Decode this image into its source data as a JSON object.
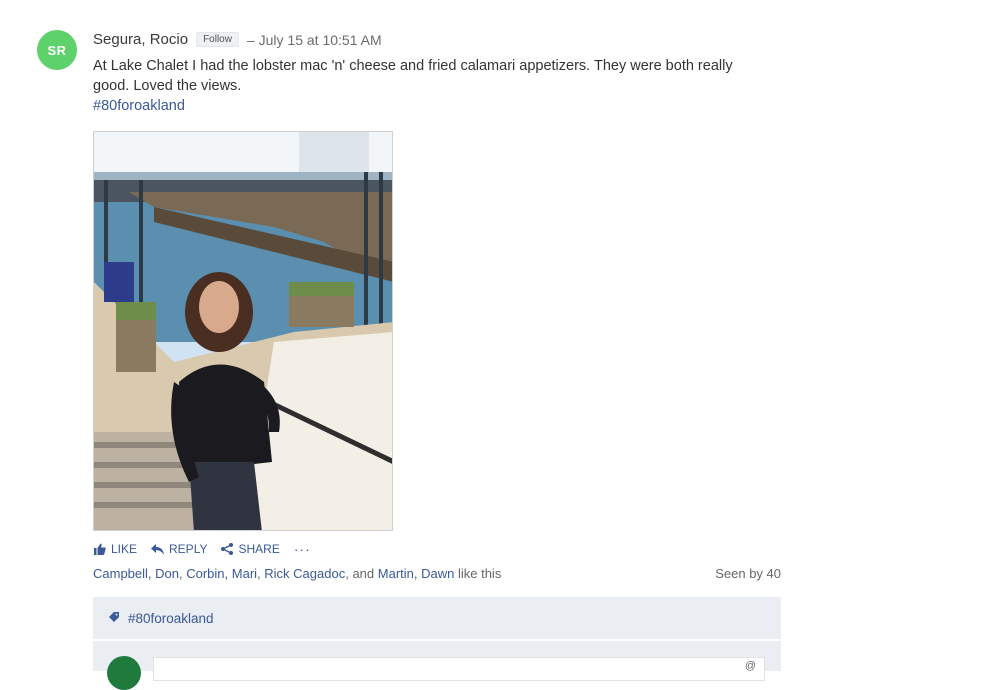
{
  "post": {
    "avatar_initials": "SR",
    "avatar_color": "#5dd16a",
    "author": "Segura, Rocio",
    "follow_label": "Follow",
    "timestamp": "– July 15 at 10:51 AM",
    "body": "At Lake Chalet I had the lobster mac 'n' cheese and fried calamari appetizers. They were both really good. Loved the views.",
    "hashtag": "#80foroakland"
  },
  "actions": {
    "like": "LIKE",
    "reply": "REPLY",
    "share": "SHARE",
    "more": "···"
  },
  "likes": {
    "people": [
      "Campbell, Don",
      "Corbin, Mari",
      "Rick Cagadoc",
      "Martin, Dawn"
    ],
    "and_text": "and",
    "suffix": "like this"
  },
  "seen": "Seen by 40",
  "topic": {
    "label": "#80foroakland"
  },
  "reply_box": {
    "placeholder": "",
    "mark": "@"
  },
  "colors": {
    "link": "#3b5998",
    "topic_bg": "#eaedf1"
  }
}
